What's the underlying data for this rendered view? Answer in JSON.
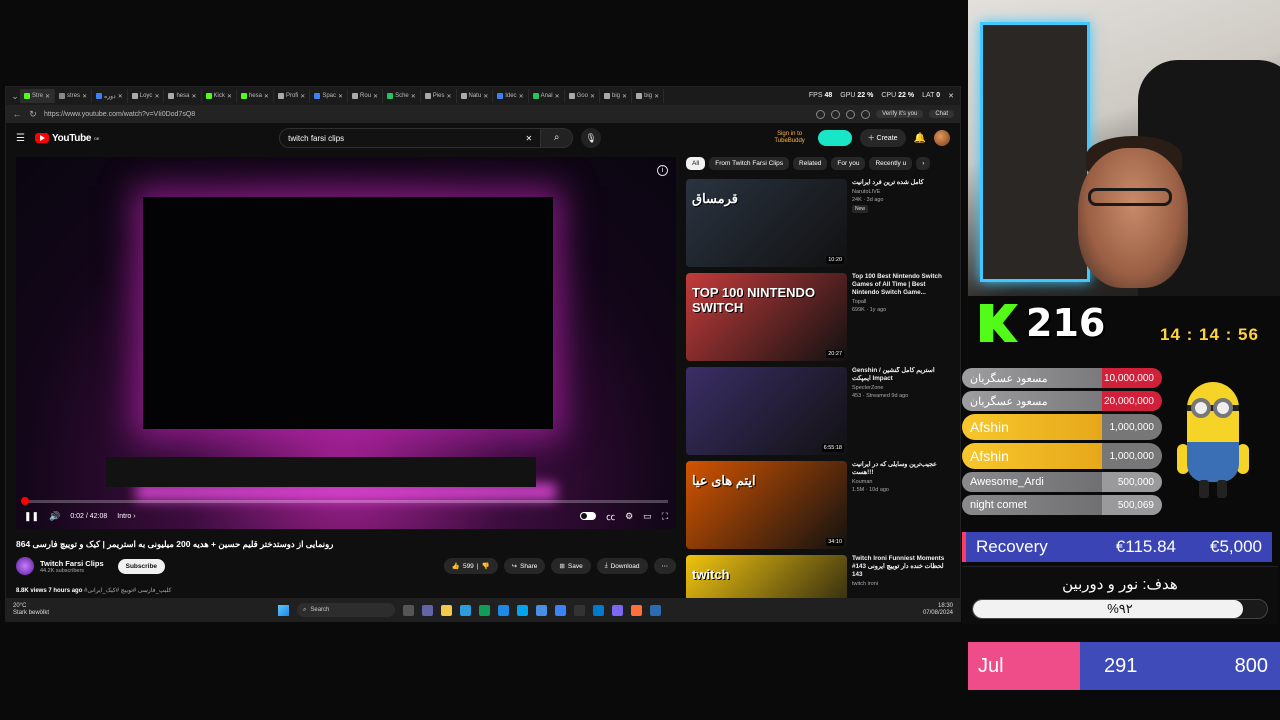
{
  "browser": {
    "tabs": [
      {
        "label": "Stre",
        "color": "#53fc18"
      },
      {
        "label": "stres",
        "color": "#888888"
      },
      {
        "label": "دوره",
        "color": "#3b82f6"
      },
      {
        "label": "Loyc",
        "color": "#aaaaaa"
      },
      {
        "label": "hesa",
        "color": "#aaaaaa"
      },
      {
        "label": "Kick",
        "color": "#53fc18"
      },
      {
        "label": "hesa",
        "color": "#53fc18"
      },
      {
        "label": "Profi",
        "color": "#aaaaaa"
      },
      {
        "label": "Spac",
        "color": "#3b82f6"
      },
      {
        "label": "Rou",
        "color": "#aaaaaa"
      },
      {
        "label": "Sche",
        "color": "#22c55e"
      },
      {
        "label": "Pies",
        "color": "#aaaaaa"
      },
      {
        "label": "Natu",
        "color": "#aaaaaa"
      },
      {
        "label": "Idec",
        "color": "#3b82f6"
      },
      {
        "label": "Anal",
        "color": "#22c55e"
      },
      {
        "label": "Goo",
        "color": "#aaaaaa"
      },
      {
        "label": "big",
        "color": "#aaaaaa"
      },
      {
        "label": "big",
        "color": "#aaaaaa"
      }
    ],
    "stats": {
      "fps_label": "FPS",
      "fps": "48",
      "gpu_label": "GPU",
      "gpu": "22 %",
      "cpu_label": "CPU",
      "cpu": "22 %",
      "lat_label": "LAT",
      "lat": "0"
    },
    "url": "https://www.youtube.com/watch?v=VIi0Dod7sQ8",
    "verify": "Verify it's you",
    "chat": "Chat"
  },
  "youtube": {
    "logo": "YouTube",
    "logo_region": "DE",
    "search_value": "twitch farsi clips",
    "signin_tubebuddy": "Sign in to TubeBuddy",
    "create": "Create",
    "player": {
      "time": "0:02 / 42:08",
      "chapter": "Intro",
      "progress": 0.001
    },
    "video": {
      "title": "رونمایی از دوستدختر قلیم حسین + هدیه 200 میلیونی به استریمر | کیک و توییچ فارسی 864",
      "channel": "Twitch Farsi Clips",
      "subscribers": "44.2K subscribers",
      "subscribe": "Subscribe",
      "likes": "599",
      "share": "Share",
      "save": "Save",
      "download": "Download",
      "views": "8.8K views",
      "age": "7 hours ago",
      "tags": "#کلیپ_فارسی #توییچ #کیک_ایرانی"
    },
    "chips": [
      "All",
      "From Twitch Farsi Clips",
      "Related",
      "For you",
      "Recently u"
    ],
    "recs": [
      {
        "title": "کامل شده ترین فرد ایرانیت",
        "channel": "NarutoLIVE",
        "meta": "24K · 3d ago",
        "badge": "New",
        "duration": "10:20",
        "thumb_text": "قرمساق",
        "bg": "#2a3340"
      },
      {
        "title": "Top 100 Best Nintendo Switch Games of All Time | Best Nintendo Switch Game...",
        "channel": "Topall",
        "meta": "699K · 1y ago",
        "badge": "",
        "duration": "20:27",
        "thumb_text": "TOP 100 NINTENDO SWITCH",
        "bg": "#c43b3b"
      },
      {
        "title": "Genshin / استریم کامل گنشین ایمپکت Impact",
        "channel": "SpecterZone",
        "meta": "453 · Streamed 9d ago",
        "badge": "",
        "duration": "6:55:18",
        "thumb_text": "",
        "bg": "#3a2e66"
      },
      {
        "title": "عجیب‌ترین وسایلی که در ایرانیت هست!!!",
        "channel": "Kouman",
        "meta": "1.5M · 10d ago",
        "badge": "",
        "duration": "34:10",
        "thumb_text": "ایتم های عیا",
        "bg": "#d35400"
      },
      {
        "title": "Twitch Ironi Funniest Moments #143 لحظات خنده دار توییچ ایرونی 143",
        "channel": "twitch ironi",
        "meta": "",
        "badge": "",
        "duration": "",
        "thumb_text": "twitch",
        "bg": "#f1c40f"
      }
    ]
  },
  "taskbar": {
    "temp": "20°C",
    "weather": "Stark bewölkt",
    "search": "Search",
    "time": "18:30",
    "date": "07/08/2024"
  },
  "overlay": {
    "viewers": "216",
    "timer": "14 : 14 : 56",
    "donors": [
      {
        "name": "مسعود عسگریان",
        "amount": "10,000,000",
        "style": "red"
      },
      {
        "name": "مسعود عسگریان",
        "amount": "20,000,000",
        "style": "red"
      },
      {
        "name": "Afshin",
        "amount": "1,000,000",
        "style": "gold"
      },
      {
        "name": "Afshin",
        "amount": "1,000,000",
        "style": "gold"
      },
      {
        "name": "Awesome_Ardi",
        "amount": "500,000",
        "style": "gray"
      },
      {
        "name": "night comet",
        "amount": "500,069",
        "style": "gray"
      }
    ],
    "recovery": {
      "label": "Recovery",
      "current": "€115.84",
      "goal": "€5,000"
    },
    "goal": {
      "label": "هدف: نور و دوربین",
      "percent_text": "%۹۲",
      "percent": 0.92
    },
    "subs": {
      "month": "Jul",
      "current": "291",
      "target": "800"
    }
  },
  "colors": {
    "accent": "#ff0000",
    "kick": "#53fc18",
    "timer": "#ffd23f",
    "recovery": "#3b44b5",
    "sub_month": "#ef4c8a"
  }
}
